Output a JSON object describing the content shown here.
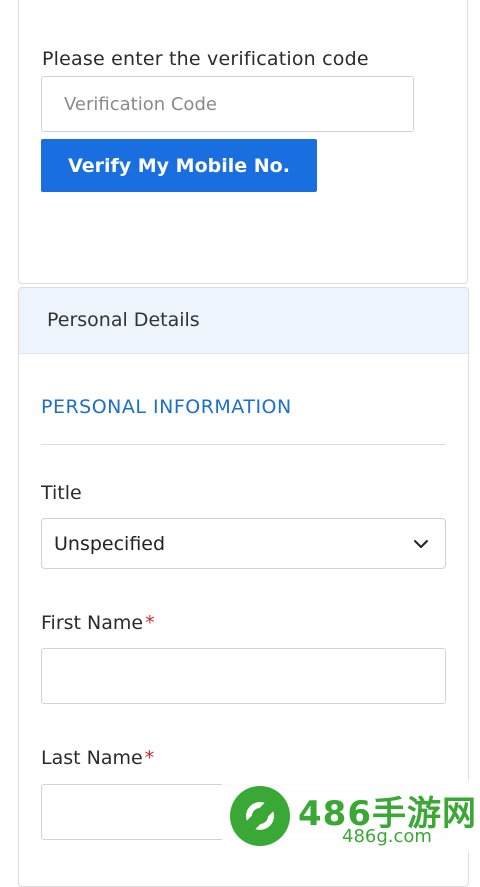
{
  "verification": {
    "label": "Please enter the verification code",
    "placeholder": "Verification Code",
    "button_label": "Verify My Mobile No."
  },
  "personal_card": {
    "header_title": "Personal Details",
    "section_title": "PERSONAL INFORMATION",
    "fields": {
      "title": {
        "label": "Title",
        "value": "Unspecified"
      },
      "first_name": {
        "label": "First Name",
        "required_mark": "*",
        "value": ""
      },
      "last_name": {
        "label": "Last Name",
        "required_mark": "*",
        "value": ""
      }
    }
  },
  "watermark": {
    "brand": "486手游网",
    "domain": "486g.com"
  },
  "colors": {
    "primary_button": "#1a6fe0",
    "section_title": "#1a6fd0",
    "header_bg": "#eef4fc",
    "required": "#d0282e",
    "watermark": "#3aa835"
  }
}
